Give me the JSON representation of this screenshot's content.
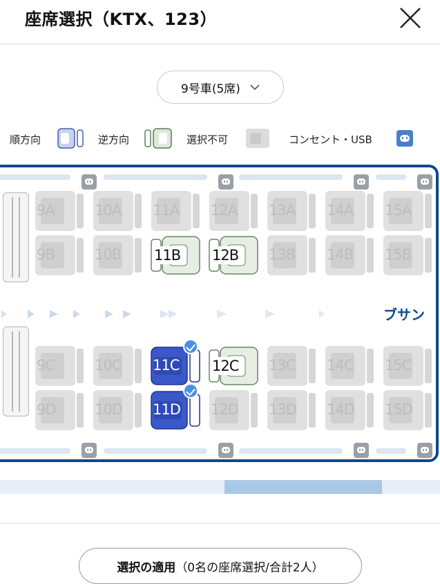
{
  "header": {
    "title": "座席選択（KTX、123）"
  },
  "car_select": {
    "label": "9号車(5席)"
  },
  "legend": {
    "forward": "順方向",
    "reverse": "逆方向",
    "unavailable": "選択不可",
    "outlet": "コンセント・USB"
  },
  "train": {
    "destination": "ブサン",
    "seats": [
      {
        "label": "9A",
        "status": "unavailable"
      },
      {
        "label": "10A",
        "status": "unavailable"
      },
      {
        "label": "11A",
        "status": "unavailable"
      },
      {
        "label": "12A",
        "status": "unavailable"
      },
      {
        "label": "13A",
        "status": "unavailable"
      },
      {
        "label": "14A",
        "status": "unavailable"
      },
      {
        "label": "15A",
        "status": "unavailable"
      },
      {
        "label": "9B",
        "status": "unavailable"
      },
      {
        "label": "10B",
        "status": "unavailable"
      },
      {
        "label": "11B",
        "status": "available"
      },
      {
        "label": "12B",
        "status": "available"
      },
      {
        "label": "13B",
        "status": "unavailable"
      },
      {
        "label": "14B",
        "status": "unavailable"
      },
      {
        "label": "15B",
        "status": "unavailable"
      },
      {
        "label": "9C",
        "status": "unavailable"
      },
      {
        "label": "10C",
        "status": "unavailable"
      },
      {
        "label": "11C",
        "status": "selected"
      },
      {
        "label": "12C",
        "status": "available"
      },
      {
        "label": "13C",
        "status": "unavailable"
      },
      {
        "label": "14C",
        "status": "unavailable"
      },
      {
        "label": "15C",
        "status": "unavailable"
      },
      {
        "label": "9D",
        "status": "unavailable"
      },
      {
        "label": "10D",
        "status": "unavailable"
      },
      {
        "label": "11D",
        "status": "selected"
      },
      {
        "label": "12D",
        "status": "unavailable"
      },
      {
        "label": "13D",
        "status": "unavailable"
      },
      {
        "label": "14D",
        "status": "unavailable"
      },
      {
        "label": "15D",
        "status": "unavailable"
      }
    ]
  },
  "scrollbar": {
    "position": 0.51
  },
  "apply": {
    "label_main": "選択の適用",
    "label_detail": "（0名の座席選択/合計2人）"
  },
  "colors": {
    "brand": "#0a4a8f",
    "selected": "#3a58c8",
    "available": "#e6eee3",
    "unavailable": "#e0e0e0"
  }
}
